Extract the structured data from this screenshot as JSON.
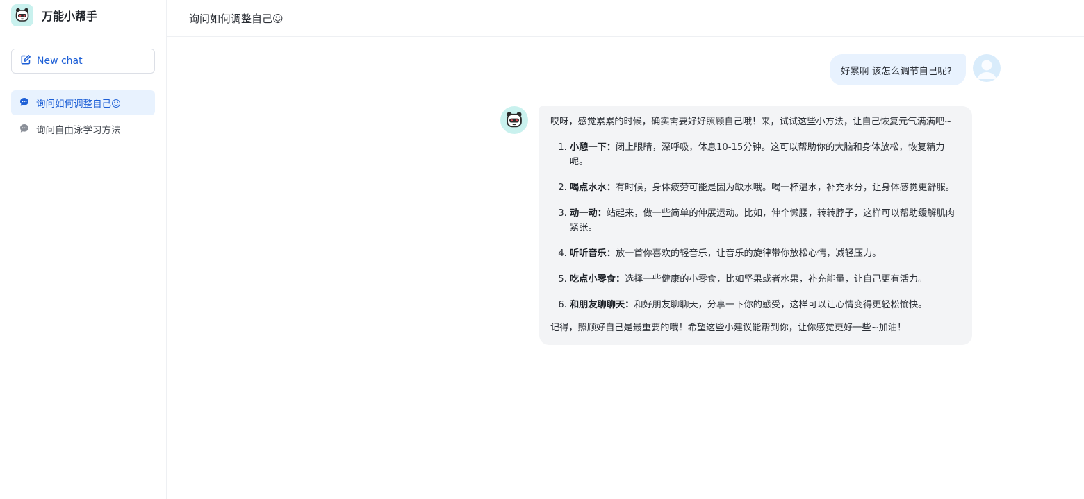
{
  "app": {
    "name": "万能小帮手",
    "brand_color": "#1d5fd6"
  },
  "sidebar": {
    "new_chat_label": "New chat",
    "conversations": [
      {
        "label": "询问如何调整自己☺",
        "active": true
      },
      {
        "label": "询问自由泳学习方法",
        "active": false
      }
    ]
  },
  "main": {
    "title": "询问如何调整自己☺",
    "messages": {
      "user": {
        "text": "好累啊 该怎么调节自己呢?"
      },
      "bot": {
        "intro": "哎呀，感觉累累的时候，确实需要好好照顾自己哦！来，试试这些小方法，让自己恢复元气满满吧~",
        "items": [
          {
            "title": "小憩一下",
            "text": "闭上眼睛，深呼吸，休息10-15分钟。这可以帮助你的大脑和身体放松，恢复精力呢。"
          },
          {
            "title": "喝点水水",
            "text": "有时候，身体疲劳可能是因为缺水哦。喝一杯温水，补充水分，让身体感觉更舒服。"
          },
          {
            "title": "动一动",
            "text": "站起来，做一些简单的伸展运动。比如，伸个懒腰，转转脖子，这样可以帮助缓解肌肉紧张。"
          },
          {
            "title": "听听音乐",
            "text": "放一首你喜欢的轻音乐，让音乐的旋律带你放松心情，减轻压力。"
          },
          {
            "title": "吃点小零食",
            "text": "选择一些健康的小零食，比如坚果或者水果，补充能量，让自己更有活力。"
          },
          {
            "title": "和朋友聊聊天",
            "text": "和好朋友聊聊天，分享一下你的感受，这样可以让心情变得更轻松愉快。"
          }
        ],
        "outro": "记得，照顾好自己是最重要的哦！希望这些小建议能帮到你，让你感觉更好一些~加油！"
      }
    }
  },
  "icons": {
    "brand_logo": "robot-face-icon",
    "new_chat": "edit-icon",
    "conversation": "chat-bubble-icon",
    "user_avatar": "user-avatar-icon",
    "bot_avatar": "robot-face-icon"
  }
}
